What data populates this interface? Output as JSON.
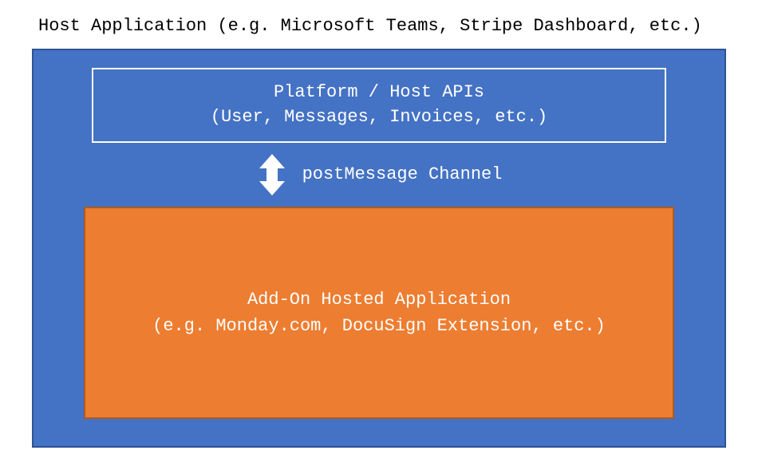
{
  "title": "Host Application (e.g. Microsoft Teams, Stripe Dashboard, etc.)",
  "apiBox": {
    "line1": "Platform / Host APIs",
    "line2": "(User, Messages, Invoices, etc.)"
  },
  "channel": {
    "label": "postMessage Channel"
  },
  "addonBox": {
    "line1": "Add-On Hosted Application",
    "line2": "(e.g. Monday.com, DocuSign Extension, etc.)"
  },
  "colors": {
    "hostBg": "#4472c4",
    "addonBg": "#ed7d31",
    "arrow": "#ffffff"
  }
}
